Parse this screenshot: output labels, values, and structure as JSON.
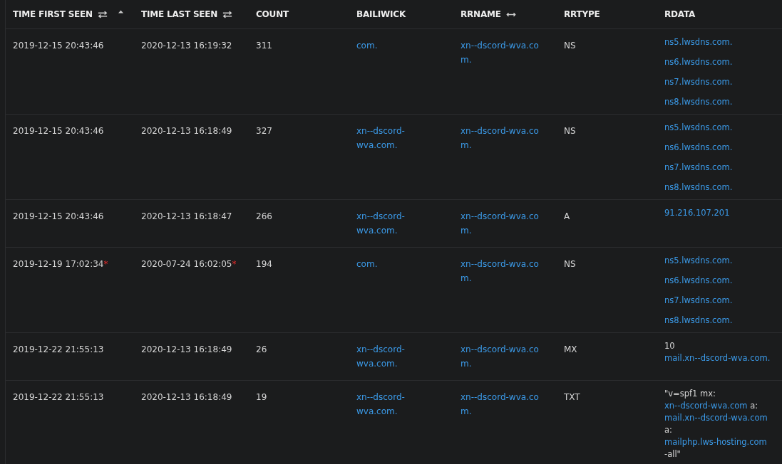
{
  "table": {
    "columns": [
      {
        "label": "TIME FIRST SEEN",
        "kind": "sortable",
        "sorted": true
      },
      {
        "label": "TIME LAST SEEN",
        "kind": "sortable",
        "sorted": false
      },
      {
        "label": "COUNT",
        "kind": "plain",
        "sorted": false
      },
      {
        "label": "BAILIWICK",
        "kind": "plain",
        "sorted": false
      },
      {
        "label": "RRNAME",
        "kind": "resizable",
        "sorted": false
      },
      {
        "label": "RRTYPE",
        "kind": "plain",
        "sorted": false
      },
      {
        "label": "RDATA",
        "kind": "plain",
        "sorted": false
      }
    ],
    "rows": [
      {
        "first_seen": "2019-12-15 20:43:46",
        "last_seen": "2020-12-13 16:19:32",
        "count": "311",
        "bailiwick": "com.",
        "rrname": "xn--dscord-wva.com.",
        "rrtype": "NS",
        "rdata": [
          {
            "parts": [
              {
                "kind": "link",
                "text": "ns5.lwsdns.com."
              }
            ]
          },
          {
            "parts": [
              {
                "kind": "link",
                "text": "ns6.lwsdns.com."
              }
            ]
          },
          {
            "parts": [
              {
                "kind": "link",
                "text": "ns7.lwsdns.com."
              }
            ]
          },
          {
            "parts": [
              {
                "kind": "link",
                "text": "ns8.lwsdns.com."
              }
            ]
          }
        ]
      },
      {
        "first_seen": "2019-12-15 20:43:46",
        "last_seen": "2020-12-13 16:18:49",
        "count": "327",
        "bailiwick": "xn--dscord-wva.com.",
        "rrname": "xn--dscord-wva.com.",
        "rrtype": "NS",
        "rdata": [
          {
            "parts": [
              {
                "kind": "link",
                "text": "ns5.lwsdns.com."
              }
            ]
          },
          {
            "parts": [
              {
                "kind": "link",
                "text": "ns6.lwsdns.com."
              }
            ]
          },
          {
            "parts": [
              {
                "kind": "link",
                "text": "ns7.lwsdns.com."
              }
            ]
          },
          {
            "parts": [
              {
                "kind": "link",
                "text": "ns8.lwsdns.com."
              }
            ]
          }
        ]
      },
      {
        "first_seen": "2019-12-15 20:43:46",
        "last_seen": "2020-12-13 16:18:47",
        "count": "266",
        "bailiwick": "xn--dscord-wva.com.",
        "rrname": "xn--dscord-wva.com.",
        "rrtype": "A",
        "rdata": [
          {
            "parts": [
              {
                "kind": "link",
                "text": "91.216.107.201"
              }
            ]
          }
        ]
      },
      {
        "first_seen": "2019-12-19 17:02:34",
        "first_seen_mark": "*",
        "last_seen": "2020-07-24 16:02:05",
        "last_seen_mark": "*",
        "count": "194",
        "bailiwick": "com.",
        "rrname": "xn--dscord-wva.com.",
        "rrtype": "NS",
        "rdata": [
          {
            "parts": [
              {
                "kind": "link",
                "text": "ns5.lwsdns.com."
              }
            ]
          },
          {
            "parts": [
              {
                "kind": "link",
                "text": "ns6.lwsdns.com."
              }
            ]
          },
          {
            "parts": [
              {
                "kind": "link",
                "text": "ns7.lwsdns.com."
              }
            ]
          },
          {
            "parts": [
              {
                "kind": "link",
                "text": "ns8.lwsdns.com."
              }
            ]
          }
        ]
      },
      {
        "first_seen": "2019-12-22 21:55:13",
        "last_seen": "2020-12-13 16:18:49",
        "count": "26",
        "bailiwick": "xn--dscord-wva.com.",
        "rrname": "xn--dscord-wva.com.",
        "rrtype": "MX",
        "rdata": [
          {
            "parts": [
              {
                "kind": "plain",
                "text": "10"
              },
              {
                "kind": "link",
                "text": "mail.xn--dscord-wva.com."
              }
            ]
          }
        ]
      },
      {
        "first_seen": "2019-12-22 21:55:13",
        "last_seen": "2020-12-13 16:18:49",
        "count": "19",
        "bailiwick": "xn--dscord-wva.com.",
        "rrname": "xn--dscord-wva.com.",
        "rrtype": "TXT",
        "rdata": [
          {
            "parts": [
              {
                "kind": "plain",
                "text": "\"v=spf1 mx:"
              },
              {
                "kind": "link",
                "text": "xn--dscord-wva.com"
              },
              {
                "kind": "plain",
                "text": "a:"
              },
              {
                "kind": "link",
                "text": "mail.xn--dscord-wva.com"
              },
              {
                "kind": "plain",
                "text": "a:"
              },
              {
                "kind": "link",
                "text": "mailphp.lws-hosting.com"
              },
              {
                "kind": "plain",
                "text": "-all\""
              }
            ]
          }
        ]
      }
    ]
  }
}
